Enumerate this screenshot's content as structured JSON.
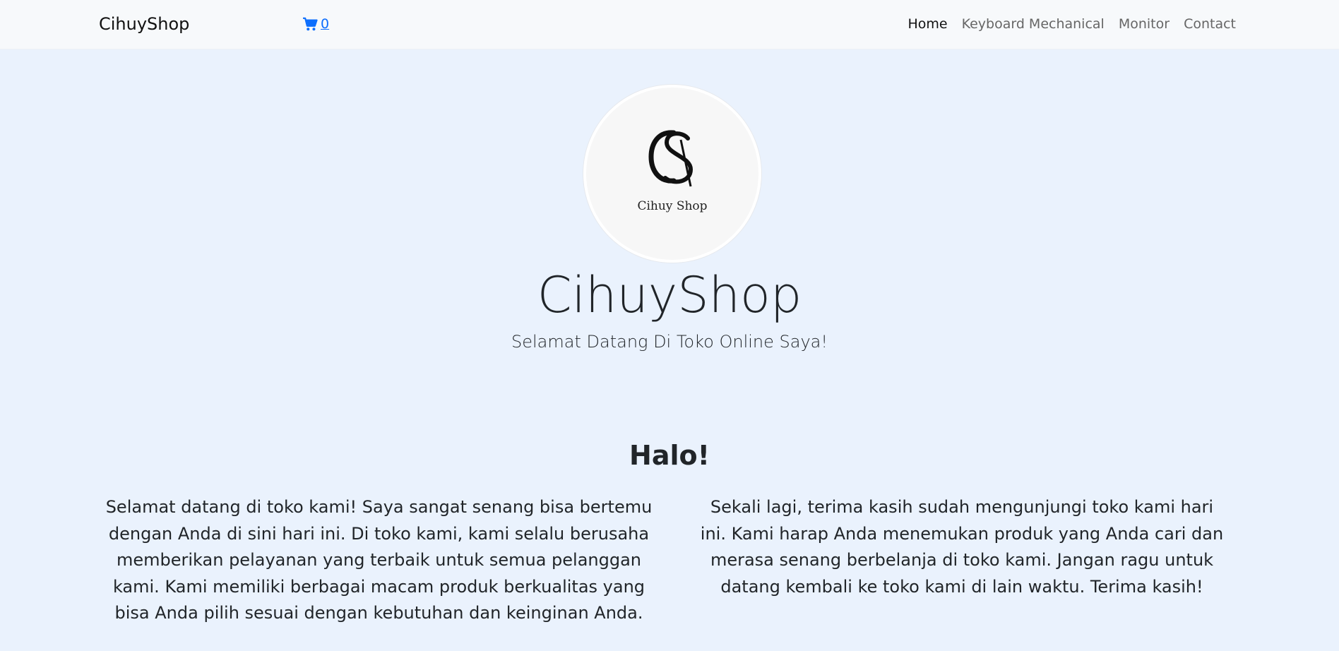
{
  "navbar": {
    "brand": "CihuyShop",
    "cart": {
      "icon": "cart-icon",
      "count": "0"
    },
    "items": [
      {
        "label": "Home",
        "active": true
      },
      {
        "label": "Keyboard Mechanical",
        "active": false
      },
      {
        "label": "Monitor",
        "active": false
      },
      {
        "label": "Contact",
        "active": false
      }
    ]
  },
  "hero": {
    "logo_text": "Cihuy Shop",
    "title": "CihuyShop",
    "subtitle": "Selamat Datang Di Toko Online Saya!"
  },
  "about": {
    "heading": "Halo!",
    "left_text": "Selamat datang di toko kami! Saya sangat senang bisa bertemu dengan Anda di sini hari ini. Di toko kami, kami selalu berusaha memberikan pelayanan yang terbaik untuk semua pelanggan kami. Kami memiliki berbagai macam produk berkualitas yang bisa Anda pilih sesuai dengan kebutuhan dan keinginan Anda.",
    "right_text": "Sekali lagi, terima kasih sudah mengunjungi toko kami hari ini. Kami harap Anda menemukan produk yang Anda cari dan merasa senang berbelanja di toko kami. Jangan ragu untuk datang kembali ke toko kami di lain waktu. Terima kasih!"
  },
  "colors": {
    "page_background": "#eaf2fd",
    "navbar_background": "#f7f9fb",
    "link": "#0d6efd",
    "text": "#212529"
  }
}
